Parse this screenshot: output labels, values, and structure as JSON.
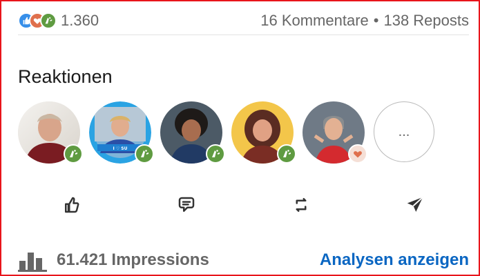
{
  "summary": {
    "reaction_types": [
      "like-icon",
      "love-icon",
      "celebrate-icon"
    ],
    "reaction_count": "1.360",
    "comments": "16 Kommentare",
    "separator": "•",
    "reposts": "138 Reposts"
  },
  "reactions": {
    "title": "Reaktionen",
    "more_label": "...",
    "avatars": [
      {
        "badge": "celebrate-icon",
        "badge_text": ""
      },
      {
        "badge": "celebrate-icon",
        "badge_text": "I ♡ SU"
      },
      {
        "badge": "celebrate-icon",
        "badge_text": ""
      },
      {
        "badge": "celebrate-icon",
        "badge_text": ""
      },
      {
        "badge": "love-icon",
        "badge_text": ""
      }
    ]
  },
  "actions": [
    "like-icon",
    "comment-icon",
    "repost-icon",
    "send-icon"
  ],
  "footer": {
    "impressions_count": "61.421",
    "impressions_label": "Impressions",
    "analytics_link": "Analysen anzeigen"
  },
  "colors": {
    "frame": "#e8141b",
    "link": "#0a66c2",
    "like": "#378fe9",
    "celebrate": "#5f9b41",
    "love": "#df704d"
  }
}
